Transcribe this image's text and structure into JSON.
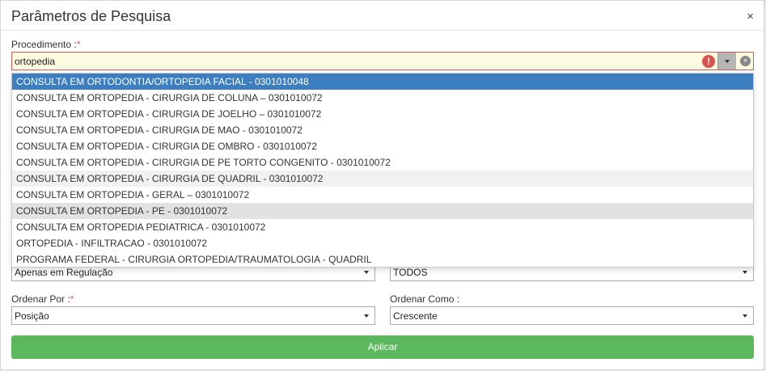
{
  "dialog": {
    "title": "Parâmetros de Pesquisa",
    "close": "×"
  },
  "procedimento": {
    "label": "Procedimento :",
    "required_mark": "*",
    "value": "ortopedia",
    "error_icon": "!",
    "clear_icon": "×",
    "options": [
      "CONSULTA EM ORTODONTIA/ORTOPEDIA FACIAL - 0301010048",
      "CONSULTA EM ORTOPEDIA - CIRURGIA DE COLUNA – 0301010072",
      "CONSULTA EM ORTOPEDIA - CIRURGIA DE JOELHO – 0301010072",
      "CONSULTA EM ORTOPEDIA - CIRURGIA DE MAO - 0301010072",
      "CONSULTA EM ORTOPEDIA - CIRURGIA DE OMBRO - 0301010072",
      "CONSULTA EM ORTOPEDIA - CIRURGIA DE PE TORTO CONGENITO - 0301010072",
      "CONSULTA EM ORTOPEDIA - CIRURGIA DE QUADRIL - 0301010072",
      "CONSULTA EM ORTOPEDIA - GERAL – 0301010072",
      "CONSULTA EM ORTOPEDIA - PE - 0301010072",
      "CONSULTA EM ORTOPEDIA PEDIATRICA - 0301010072",
      "ORTOPEDIA - INFILTRACAO - 0301010072",
      "PROGRAMA FEDERAL - CIRURGIA ORTOPEDIA/TRAUMATOLOGIA - QUADRIL"
    ]
  },
  "regulacao_select": {
    "value": "Apenas em Regulação"
  },
  "status_select": {
    "value": "TODOS"
  },
  "ordenar_por": {
    "label": "Ordenar Por :",
    "required_mark": "*",
    "value": "Posição"
  },
  "ordenar_como": {
    "label": "Ordenar Como :",
    "value": "Crescente"
  },
  "apply_button": {
    "label": "Aplicar"
  },
  "colors": {
    "accent": "#3c7ebf",
    "apply": "#5cb85c",
    "error": "#d9534f",
    "field_warning_bg": "#fffbe0"
  }
}
